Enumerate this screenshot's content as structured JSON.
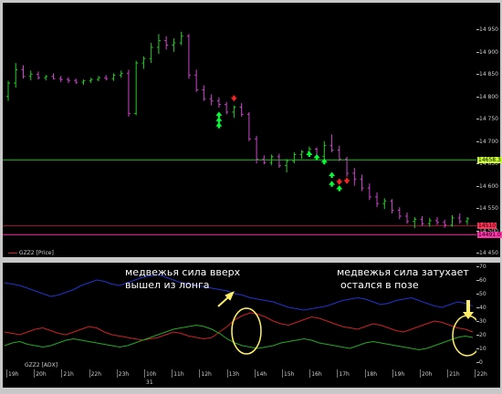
{
  "colors": {
    "background": "#000000",
    "bull_bar": "#22cc22",
    "bear_bar": "#cc44cc",
    "buy_arrow": "#00ff33",
    "sell_arrow": "#ff2222",
    "green_level": "#22cc22",
    "red_level": "#dd2244",
    "magenta_level": "#ff00aa",
    "di_plus": "#22aa22",
    "di_minus": "#cc2222",
    "adx": "#2233cc",
    "highlight_ellipse": "#ffee66"
  },
  "price_axis": {
    "labels": [
      "14 950",
      "14 900",
      "14 850",
      "14 800",
      "14 750",
      "14 700",
      "14 650",
      "14 600",
      "14 550",
      "14 500",
      "14 450"
    ],
    "ymin": 14440,
    "ymax": 15010,
    "green_level": 14658,
    "green_level_tag": "14658.3",
    "red_level": 14510,
    "red_level_tag": "14510",
    "magenta_level": 14490,
    "magenta_level_tag": "14491.0"
  },
  "indicator_axis": {
    "labels": [
      "70",
      "60",
      "50",
      "40",
      "30",
      "20",
      "10",
      "0"
    ]
  },
  "legends": {
    "price": "GZZ2 [Price]",
    "indicator": "GZZ2 [ADX]"
  },
  "annotations": {
    "left_line1": "медвежья сила вверх",
    "left_line2": "вышел из лонга",
    "right_line1": "медвежья сила затухает",
    "right_line2": "остался в позе"
  },
  "time_axis": {
    "labels": [
      "19h",
      "20h",
      "21h",
      "22h",
      "23h",
      "10h",
      "11h",
      "12h",
      "13h",
      "14h",
      "15h",
      "16h",
      "17h",
      "18h",
      "19h",
      "20h",
      "21h",
      "22h"
    ],
    "day_label": "31"
  },
  "chart_data": {
    "type": "candlestick",
    "bars": [
      [
        14800,
        14835,
        14790,
        14830
      ],
      [
        14830,
        14875,
        14820,
        14860
      ],
      [
        14860,
        14870,
        14840,
        14845
      ],
      [
        14845,
        14858,
        14836,
        14850
      ],
      [
        14850,
        14856,
        14838,
        14842
      ],
      [
        14842,
        14848,
        14836,
        14845
      ],
      [
        14845,
        14852,
        14838,
        14840
      ],
      [
        14840,
        14846,
        14832,
        14838
      ],
      [
        14838,
        14843,
        14830,
        14836
      ],
      [
        14836,
        14840,
        14828,
        14832
      ],
      [
        14832,
        14838,
        14826,
        14835
      ],
      [
        14835,
        14842,
        14830,
        14838
      ],
      [
        14838,
        14846,
        14834,
        14842
      ],
      [
        14842,
        14848,
        14836,
        14840
      ],
      [
        14840,
        14852,
        14835,
        14848
      ],
      [
        14848,
        14858,
        14842,
        14852
      ],
      [
        14852,
        14860,
        14755,
        14762
      ],
      [
        14762,
        14880,
        14758,
        14875
      ],
      [
        14875,
        14890,
        14862,
        14885
      ],
      [
        14885,
        14920,
        14875,
        14910
      ],
      [
        14910,
        14940,
        14895,
        14925
      ],
      [
        14925,
        14935,
        14905,
        14915
      ],
      [
        14915,
        14930,
        14900,
        14920
      ],
      [
        14920,
        14945,
        14915,
        14935
      ],
      [
        14935,
        14940,
        14840,
        14848
      ],
      [
        14848,
        14860,
        14810,
        14815
      ],
      [
        14815,
        14825,
        14790,
        14795
      ],
      [
        14795,
        14805,
        14780,
        14790
      ],
      [
        14790,
        14798,
        14775,
        14782
      ],
      [
        14782,
        14788,
        14760,
        14765
      ],
      [
        14765,
        14780,
        14752,
        14776
      ],
      [
        14776,
        14785,
        14755,
        14760
      ],
      [
        14760,
        14765,
        14700,
        14705
      ],
      [
        14705,
        14712,
        14650,
        14660
      ],
      [
        14660,
        14668,
        14648,
        14652
      ],
      [
        14652,
        14670,
        14646,
        14665
      ],
      [
        14665,
        14672,
        14640,
        14645
      ],
      [
        14645,
        14660,
        14630,
        14655
      ],
      [
        14655,
        14675,
        14650,
        14670
      ],
      [
        14670,
        14680,
        14660,
        14676
      ],
      [
        14676,
        14688,
        14670,
        14682
      ],
      [
        14682,
        14686,
        14662,
        14666
      ],
      [
        14666,
        14700,
        14660,
        14690
      ],
      [
        14690,
        14715,
        14675,
        14680
      ],
      [
        14680,
        14690,
        14655,
        14660
      ],
      [
        14660,
        14665,
        14620,
        14628
      ],
      [
        14628,
        14640,
        14600,
        14615
      ],
      [
        14615,
        14625,
        14588,
        14595
      ],
      [
        14595,
        14605,
        14568,
        14575
      ],
      [
        14575,
        14585,
        14552,
        14560
      ],
      [
        14560,
        14572,
        14548,
        14566
      ],
      [
        14566,
        14570,
        14538,
        14545
      ],
      [
        14545,
        14552,
        14525,
        14532
      ],
      [
        14532,
        14540,
        14515,
        14520
      ],
      [
        14520,
        14530,
        14505,
        14525
      ],
      [
        14525,
        14532,
        14510,
        14515
      ],
      [
        14515,
        14528,
        14508,
        14522
      ],
      [
        14522,
        14530,
        14512,
        14518
      ],
      [
        14518,
        14524,
        14506,
        14512
      ],
      [
        14512,
        14534,
        14508,
        14528
      ],
      [
        14528,
        14538,
        14515,
        14520
      ],
      [
        14520,
        14530,
        14512,
        14526
      ]
    ],
    "buy_signals": [
      {
        "bar": 28,
        "price": 14760
      },
      {
        "bar": 28,
        "price": 14748
      },
      {
        "bar": 28,
        "price": 14736
      },
      {
        "bar": 40,
        "price": 14672
      },
      {
        "bar": 41,
        "price": 14665
      },
      {
        "bar": 42,
        "price": 14655
      },
      {
        "bar": 43,
        "price": 14625
      },
      {
        "bar": 43,
        "price": 14605
      },
      {
        "bar": 44,
        "price": 14595
      }
    ],
    "sell_signals": [
      {
        "bar": 30,
        "price": 14795
      },
      {
        "bar": 44,
        "price": 14608
      },
      {
        "bar": 45,
        "price": 14610
      }
    ],
    "indicator": {
      "adx": [
        58,
        57,
        56,
        54,
        52,
        50,
        48,
        49,
        51,
        53,
        56,
        58,
        60,
        59,
        57,
        56,
        58,
        60,
        62,
        63,
        64,
        62,
        60,
        58,
        57,
        56,
        55,
        54,
        53,
        52,
        50,
        49,
        47,
        46,
        45,
        44,
        42,
        40,
        39,
        38,
        39,
        40,
        41,
        43,
        45,
        46,
        47,
        46,
        44,
        42,
        43,
        45,
        46,
        47,
        45,
        43,
        41,
        40,
        42,
        44,
        43,
        41
      ],
      "di_minus": [
        22,
        21,
        20,
        22,
        24,
        25,
        23,
        21,
        20,
        22,
        24,
        26,
        25,
        22,
        20,
        19,
        18,
        17,
        16,
        17,
        18,
        20,
        22,
        21,
        19,
        18,
        17,
        18,
        22,
        26,
        31,
        34,
        36,
        35,
        33,
        30,
        28,
        27,
        29,
        31,
        33,
        32,
        30,
        28,
        26,
        25,
        24,
        26,
        28,
        27,
        25,
        23,
        22,
        24,
        26,
        28,
        30,
        29,
        27,
        25,
        24,
        22
      ],
      "di_plus": [
        12,
        14,
        15,
        13,
        12,
        11,
        12,
        14,
        16,
        17,
        16,
        15,
        14,
        13,
        12,
        11,
        12,
        14,
        16,
        18,
        20,
        22,
        24,
        25,
        26,
        27,
        26,
        24,
        21,
        17,
        14,
        12,
        11,
        10,
        11,
        12,
        14,
        15,
        16,
        17,
        16,
        14,
        13,
        12,
        11,
        10,
        12,
        14,
        15,
        14,
        13,
        12,
        11,
        10,
        9,
        10,
        12,
        14,
        16,
        18,
        19,
        18
      ]
    }
  }
}
